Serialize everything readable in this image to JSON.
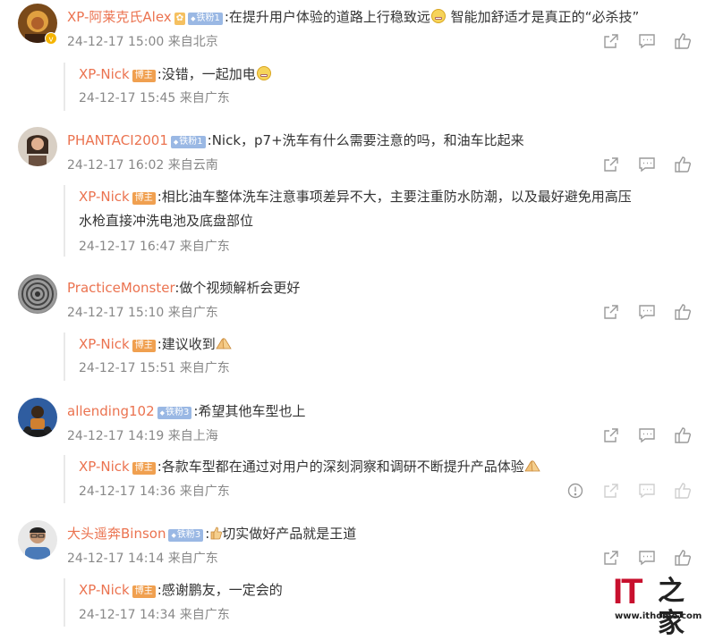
{
  "comments": [
    {
      "user": "XP-阿莱克氏Alex",
      "fan_badge": "铁粉1",
      "text": ":在提升用户体验的道路上行稳致远",
      "text_tail": " 智能加舒适才是真正的“必杀技”",
      "meta": "24-12-17 15:00 来自北京",
      "reply": {
        "user": "XP-Nick",
        "host_badge": "博主",
        "text": ":没错，一起加电",
        "meta": "24-12-17 15:45 来自广东"
      }
    },
    {
      "user": "PHANTACI2001",
      "fan_badge": "铁粉1",
      "text": ":Nick，p7+洗车有什么需要注意的吗，和油车比起来",
      "meta": "24-12-17 16:02 来自云南",
      "reply": {
        "user": "XP-Nick",
        "host_badge": "博主",
        "text": ":相比油车整体洗车注意事项差异不大，主要注重防水防潮，以及最好避免用高压",
        "text_line2": "水枪直接冲洗电池及底盘部位",
        "meta": "24-12-17 16:47 来自广东"
      }
    },
    {
      "user": "PracticeMonster",
      "text": ":做个视频解析会更好",
      "meta": "24-12-17 15:10 来自广东",
      "reply": {
        "user": "XP-Nick",
        "host_badge": "博主",
        "text": ":建议收到",
        "meta": "24-12-17 15:51 来自广东"
      }
    },
    {
      "user": "allending102",
      "fan_badge": "铁粉3",
      "text": ":希望其他车型也上",
      "meta": "24-12-17 14:19 来自上海",
      "reply": {
        "user": "XP-Nick",
        "host_badge": "博主",
        "text": ":各款车型都在通过对用户的深刻洞察和调研不断提升产品体验",
        "meta": "24-12-17 14:36 来自广东"
      }
    },
    {
      "user": "大头遥奔Binson",
      "fan_badge": "铁粉3",
      "text": "切实做好产品就是王道",
      "text_prefix": ":",
      "meta": "24-12-17 14:14 来自广东",
      "reply": {
        "user": "XP-Nick",
        "host_badge": "博主",
        "text": ":感谢鹏友，一定会的",
        "meta": "24-12-17 14:34 来自广东"
      }
    }
  ],
  "watermark": {
    "brand": "IT",
    "home": "之家",
    "url": "www.ithome.com"
  },
  "colors": {
    "username": "#eb7350",
    "meta": "#888888",
    "fan_badge": "#9ab8e4",
    "host_badge": "#f0a050",
    "icon": "#9a9a9a",
    "brand_red": "#c8102e"
  },
  "icons": [
    "share-icon",
    "comment-icon",
    "like-icon",
    "report-icon",
    "grin-emoji-icon",
    "pray-emoji-icon",
    "thumbs-up-emoji-icon"
  ]
}
